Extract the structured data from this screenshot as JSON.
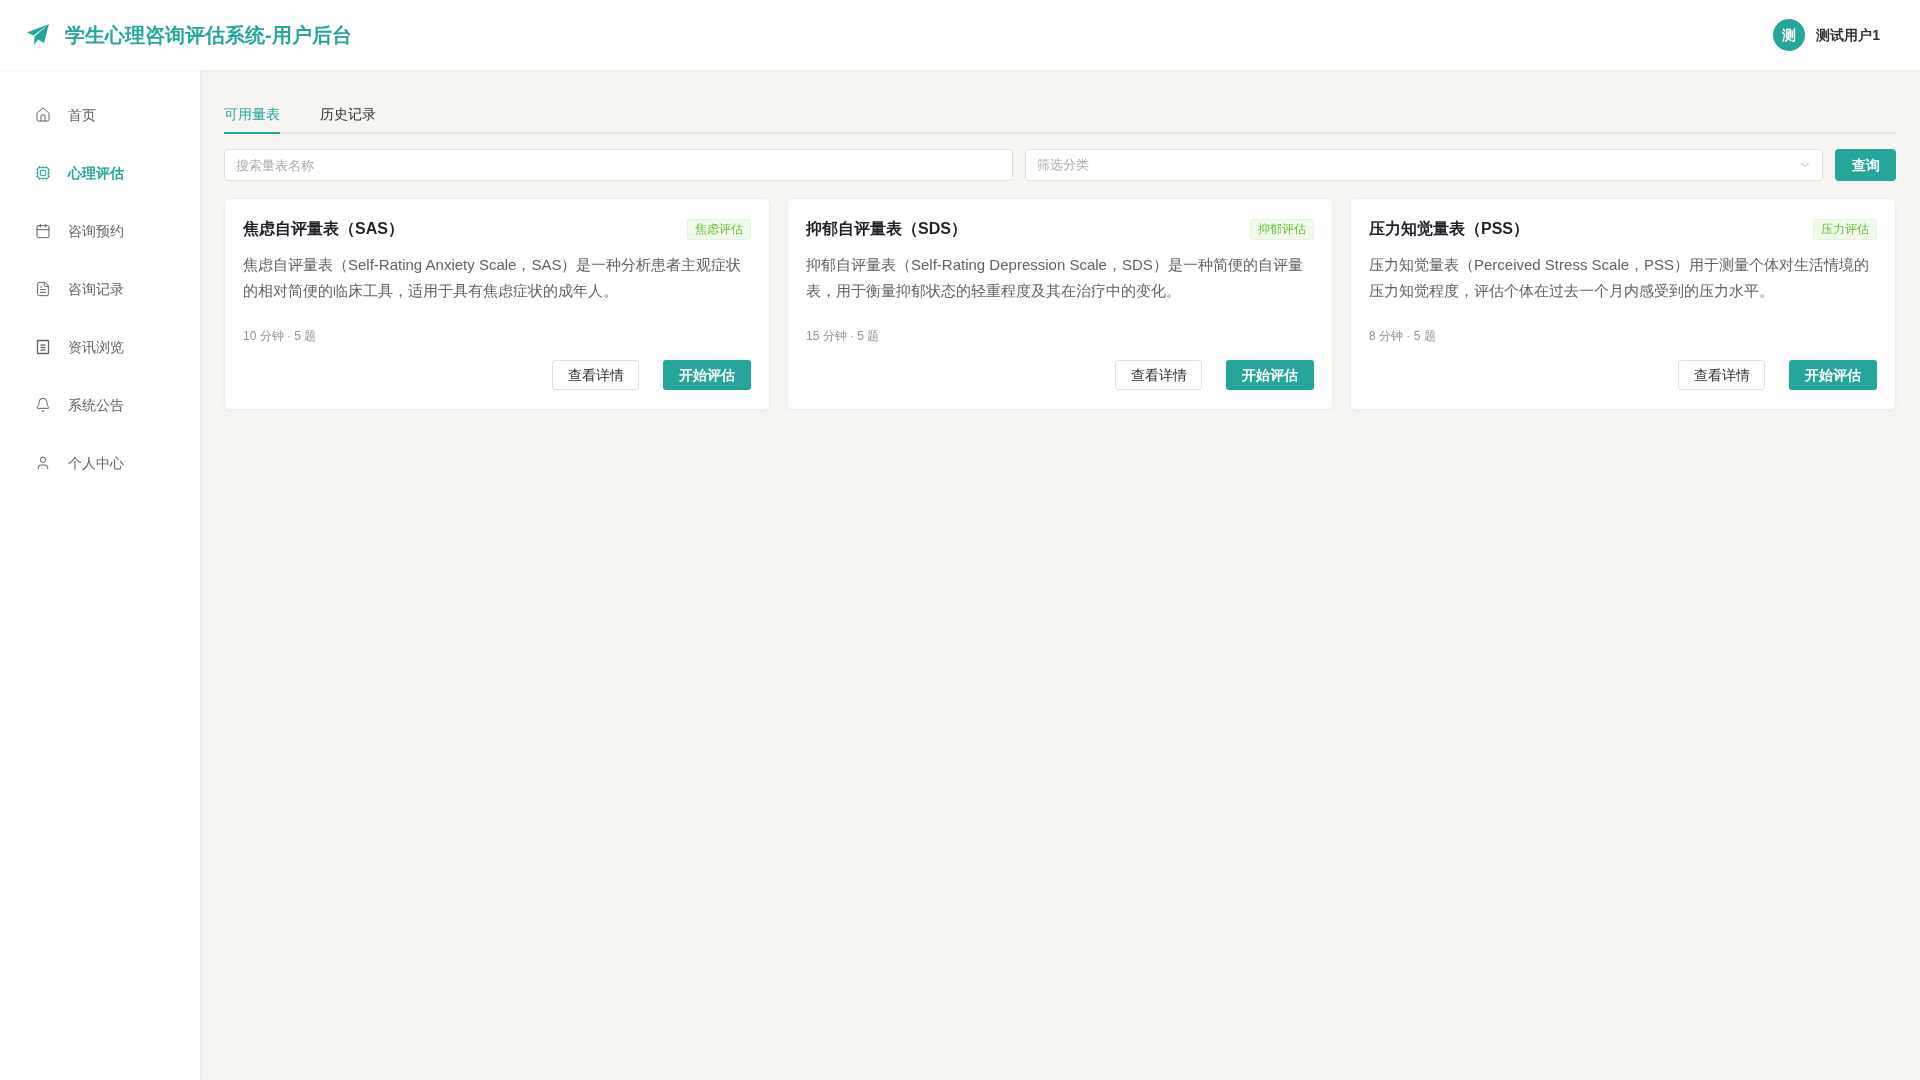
{
  "header": {
    "title": "学生心理咨询评估系统-用户后台",
    "user": {
      "avatar_text": "测",
      "name": "测试用户1"
    }
  },
  "sidebar": {
    "items": [
      {
        "label": "首页",
        "selected": false
      },
      {
        "label": "心理评估",
        "selected": true
      },
      {
        "label": "咨询预约",
        "selected": false
      },
      {
        "label": "咨询记录",
        "selected": false
      },
      {
        "label": "资讯浏览",
        "selected": false
      },
      {
        "label": "系统公告",
        "selected": false
      },
      {
        "label": "个人中心",
        "selected": false
      }
    ]
  },
  "tabs": [
    {
      "label": "可用量表",
      "selected": true
    },
    {
      "label": "历史记录",
      "selected": false
    }
  ],
  "search": {
    "placeholder": "搜索量表名称"
  },
  "filter": {
    "placeholder": "筛选分类"
  },
  "query_button": "查询",
  "cards": [
    {
      "title": "焦虑自评量表（SAS）",
      "tag": "焦虑评估",
      "description": "焦虑自评量表（Self-Rating Anxiety Scale，SAS）是一种分析患者主观症状的相对简便的临床工具，适用于具有焦虑症状的成年人。",
      "meta": "10 分钟 · 5 题",
      "details_button": "查看详情",
      "start_button": "开始评估"
    },
    {
      "title": "抑郁自评量表（SDS）",
      "tag": "抑郁评估",
      "description": "抑郁自评量表（Self-Rating Depression Scale，SDS）是一种简便的自评量表，用于衡量抑郁状态的轻重程度及其在治疗中的变化。",
      "meta": "15 分钟 · 5 题",
      "details_button": "查看详情",
      "start_button": "开始评估"
    },
    {
      "title": "压力知觉量表（PSS）",
      "tag": "压力评估",
      "description": "压力知觉量表（Perceived Stress Scale，PSS）用于测量个体对生活情境的压力知觉程度，评估个体在过去一个月内感受到的压力水平。",
      "meta": "8 分钟 · 5 题",
      "details_button": "查看详情",
      "start_button": "开始评估"
    }
  ]
}
